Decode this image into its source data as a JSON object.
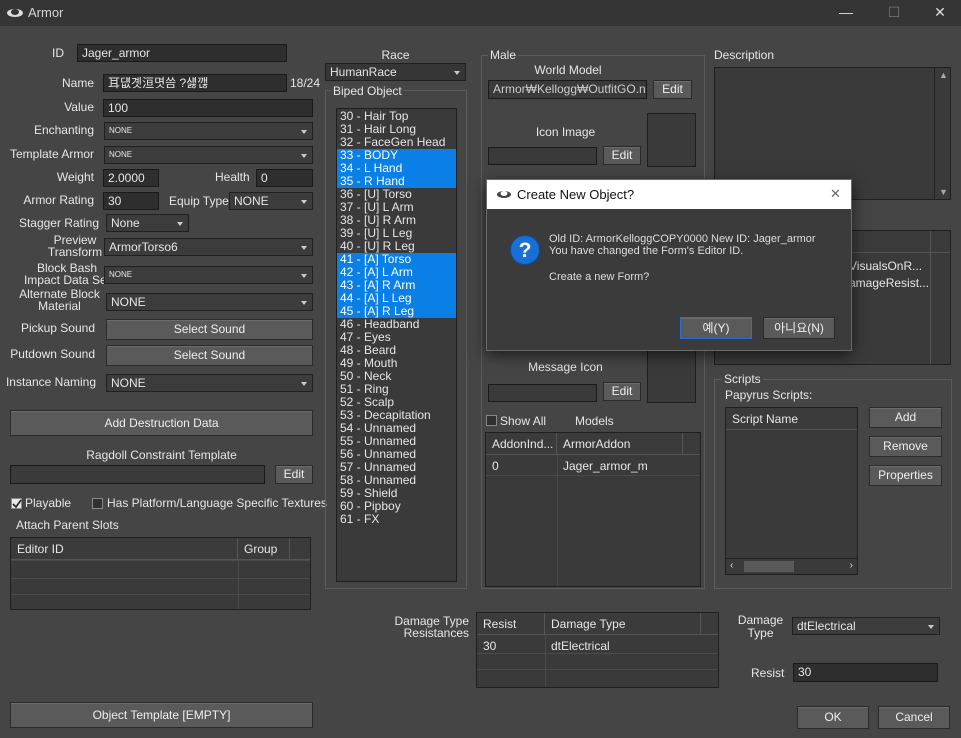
{
  "window": {
    "title": "Armor",
    "min": "—",
    "max": "☐",
    "close": "✕"
  },
  "left": {
    "id_label": "ID",
    "id_value": "Jager_armor",
    "name_label": "Name",
    "name_value": "耳덊곗洹몃씀 ?섏깮",
    "name_count": "18/24",
    "value_label": "Value",
    "value_value": "100",
    "enchanting_label": "Enchanting",
    "enchanting_value": "NONE",
    "template_label": "Template Armor",
    "template_value": "NONE",
    "weight_label": "Weight",
    "weight_value": "2.0000",
    "health_label": "Health",
    "health_value": "0",
    "rating_label": "Armor Rating",
    "rating_value": "30",
    "equip_label": "Equip Type",
    "equip_value": "NONE",
    "stagger_label": "Stagger Rating",
    "stagger_value": "None",
    "preview_label": "Preview\nTransform",
    "preview_value": "ArmorTorso6",
    "blockbash_label": "Block Bash\nImpact Data Set",
    "blockbash_value": "NONE",
    "altblock_label": "Alternate Block\nMaterial",
    "altblock_value": "NONE",
    "pickup_label": "Pickup Sound",
    "pickup_btn": "Select Sound",
    "putdown_label": "Putdown Sound",
    "putdown_btn": "Select Sound",
    "naming_label": "Instance Naming",
    "naming_value": "NONE",
    "destruction_btn": "Add Destruction Data",
    "ragdoll_label": "Ragdoll Constraint Template",
    "ragdoll_edit": "Edit",
    "playable_label": "Playable",
    "platform_label": "Has Platform/Language Specific Textures",
    "attach_label": "Attach Parent Slots",
    "attach_cols": [
      "Editor ID",
      "Group"
    ],
    "objtemplate_btn": "Object Template [EMPTY]"
  },
  "race": {
    "label": "Race",
    "value": "HumanRace",
    "biped_label": "Biped Object",
    "items": [
      "30 - Hair Top",
      "31 - Hair Long",
      "32 - FaceGen Head",
      "33 - BODY",
      "34 - L Hand",
      "35 - R Hand",
      "36 - [U] Torso",
      "37 - [U] L Arm",
      "38 - [U] R Arm",
      "39 - [U] L Leg",
      "40 - [U] R Leg",
      "41 - [A] Torso",
      "42 - [A] L Arm",
      "43 - [A] R Arm",
      "44 - [A] L Leg",
      "45 - [A] R Leg",
      "46 - Headband",
      "47 - Eyes",
      "48 - Beard",
      "49 - Mouth",
      "50 - Neck",
      "51 - Ring",
      "52 - Scalp",
      "53 - Decapitation",
      "54 - Unnamed",
      "55 - Unnamed",
      "56 - Unnamed",
      "57 - Unnamed",
      "58 - Unnamed",
      "59 - Shield",
      "60 - Pipboy",
      "61 - FX"
    ],
    "selected": [
      3,
      4,
      5,
      11,
      12,
      13,
      14,
      15
    ]
  },
  "male": {
    "label": "Male",
    "world_label": "World Model",
    "world_value": "Armor₩Kellogg₩OutfitGO.nif",
    "world_edit": "Edit",
    "icon_label": "Icon Image",
    "icon_edit": "Edit",
    "msg_label": "Message Icon",
    "msg_edit": "Edit",
    "showall_label": "Show All",
    "models_label": "Models",
    "addon_cols": [
      "AddonInd...",
      "ArmorAddon"
    ],
    "addon_rows": [
      [
        "0",
        "Jager_armor_m"
      ]
    ]
  },
  "description": {
    "label": "Description"
  },
  "props": {
    "row1": "VisualsOnR...",
    "row2": "amageResist..."
  },
  "scripts": {
    "label": "Scripts",
    "papyrus_label": "Papyrus Scripts:",
    "col": "Script Name",
    "add": "Add",
    "remove": "Remove",
    "properties": "Properties"
  },
  "damage": {
    "label": "Damage Type\nResistances",
    "cols": [
      "Resist",
      "Damage Type"
    ],
    "rows": [
      [
        "30",
        "dtElectrical"
      ]
    ],
    "type_label": "Damage\nType",
    "type_value": "dtElectrical",
    "resist_label": "Resist",
    "resist_value": "30"
  },
  "footer": {
    "ok": "OK",
    "cancel": "Cancel"
  },
  "dialog": {
    "title": "Create New Object?",
    "line1": "Old ID: ArmorKelloggCOPY0000 New ID: Jager_armor",
    "line2": "You have changed the Form's Editor ID.",
    "line3": "Create a new Form?",
    "yes": "예(Y)",
    "no": "아니요(N)",
    "icon": "?"
  },
  "colors": {
    "selection": "#0a7fe6",
    "bg": "#454545",
    "dialog_icon": "#1a6fd6"
  }
}
